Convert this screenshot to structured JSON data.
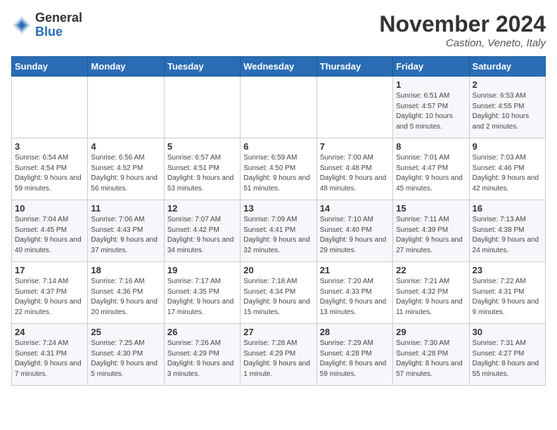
{
  "header": {
    "logo": {
      "general": "General",
      "blue": "Blue"
    },
    "month": "November 2024",
    "location": "Castion, Veneto, Italy"
  },
  "weekdays": [
    "Sunday",
    "Monday",
    "Tuesday",
    "Wednesday",
    "Thursday",
    "Friday",
    "Saturday"
  ],
  "weeks": [
    [
      {
        "day": "",
        "info": ""
      },
      {
        "day": "",
        "info": ""
      },
      {
        "day": "",
        "info": ""
      },
      {
        "day": "",
        "info": ""
      },
      {
        "day": "",
        "info": ""
      },
      {
        "day": "1",
        "info": "Sunrise: 6:51 AM\nSunset: 4:57 PM\nDaylight: 10 hours and 5 minutes."
      },
      {
        "day": "2",
        "info": "Sunrise: 6:53 AM\nSunset: 4:55 PM\nDaylight: 10 hours and 2 minutes."
      }
    ],
    [
      {
        "day": "3",
        "info": "Sunrise: 6:54 AM\nSunset: 4:54 PM\nDaylight: 9 hours and 59 minutes."
      },
      {
        "day": "4",
        "info": "Sunrise: 6:56 AM\nSunset: 4:52 PM\nDaylight: 9 hours and 56 minutes."
      },
      {
        "day": "5",
        "info": "Sunrise: 6:57 AM\nSunset: 4:51 PM\nDaylight: 9 hours and 53 minutes."
      },
      {
        "day": "6",
        "info": "Sunrise: 6:59 AM\nSunset: 4:50 PM\nDaylight: 9 hours and 51 minutes."
      },
      {
        "day": "7",
        "info": "Sunrise: 7:00 AM\nSunset: 4:48 PM\nDaylight: 9 hours and 48 minutes."
      },
      {
        "day": "8",
        "info": "Sunrise: 7:01 AM\nSunset: 4:47 PM\nDaylight: 9 hours and 45 minutes."
      },
      {
        "day": "9",
        "info": "Sunrise: 7:03 AM\nSunset: 4:46 PM\nDaylight: 9 hours and 42 minutes."
      }
    ],
    [
      {
        "day": "10",
        "info": "Sunrise: 7:04 AM\nSunset: 4:45 PM\nDaylight: 9 hours and 40 minutes."
      },
      {
        "day": "11",
        "info": "Sunrise: 7:06 AM\nSunset: 4:43 PM\nDaylight: 9 hours and 37 minutes."
      },
      {
        "day": "12",
        "info": "Sunrise: 7:07 AM\nSunset: 4:42 PM\nDaylight: 9 hours and 34 minutes."
      },
      {
        "day": "13",
        "info": "Sunrise: 7:09 AM\nSunset: 4:41 PM\nDaylight: 9 hours and 32 minutes."
      },
      {
        "day": "14",
        "info": "Sunrise: 7:10 AM\nSunset: 4:40 PM\nDaylight: 9 hours and 29 minutes."
      },
      {
        "day": "15",
        "info": "Sunrise: 7:11 AM\nSunset: 4:39 PM\nDaylight: 9 hours and 27 minutes."
      },
      {
        "day": "16",
        "info": "Sunrise: 7:13 AM\nSunset: 4:38 PM\nDaylight: 9 hours and 24 minutes."
      }
    ],
    [
      {
        "day": "17",
        "info": "Sunrise: 7:14 AM\nSunset: 4:37 PM\nDaylight: 9 hours and 22 minutes."
      },
      {
        "day": "18",
        "info": "Sunrise: 7:16 AM\nSunset: 4:36 PM\nDaylight: 9 hours and 20 minutes."
      },
      {
        "day": "19",
        "info": "Sunrise: 7:17 AM\nSunset: 4:35 PM\nDaylight: 9 hours and 17 minutes."
      },
      {
        "day": "20",
        "info": "Sunrise: 7:18 AM\nSunset: 4:34 PM\nDaylight: 9 hours and 15 minutes."
      },
      {
        "day": "21",
        "info": "Sunrise: 7:20 AM\nSunset: 4:33 PM\nDaylight: 9 hours and 13 minutes."
      },
      {
        "day": "22",
        "info": "Sunrise: 7:21 AM\nSunset: 4:32 PM\nDaylight: 9 hours and 11 minutes."
      },
      {
        "day": "23",
        "info": "Sunrise: 7:22 AM\nSunset: 4:31 PM\nDaylight: 9 hours and 9 minutes."
      }
    ],
    [
      {
        "day": "24",
        "info": "Sunrise: 7:24 AM\nSunset: 4:31 PM\nDaylight: 9 hours and 7 minutes."
      },
      {
        "day": "25",
        "info": "Sunrise: 7:25 AM\nSunset: 4:30 PM\nDaylight: 9 hours and 5 minutes."
      },
      {
        "day": "26",
        "info": "Sunrise: 7:26 AM\nSunset: 4:29 PM\nDaylight: 9 hours and 3 minutes."
      },
      {
        "day": "27",
        "info": "Sunrise: 7:28 AM\nSunset: 4:29 PM\nDaylight: 9 hours and 1 minute."
      },
      {
        "day": "28",
        "info": "Sunrise: 7:29 AM\nSunset: 4:28 PM\nDaylight: 8 hours and 59 minutes."
      },
      {
        "day": "29",
        "info": "Sunrise: 7:30 AM\nSunset: 4:28 PM\nDaylight: 8 hours and 57 minutes."
      },
      {
        "day": "30",
        "info": "Sunrise: 7:31 AM\nSunset: 4:27 PM\nDaylight: 8 hours and 55 minutes."
      }
    ]
  ]
}
